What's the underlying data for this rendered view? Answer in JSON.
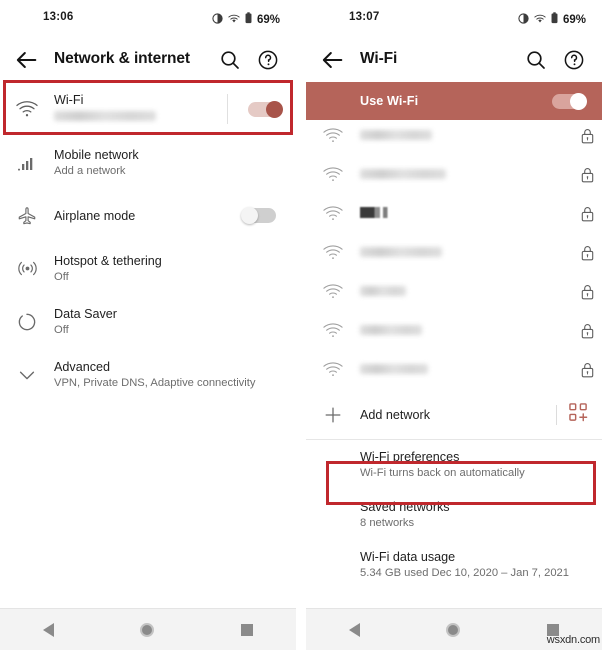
{
  "theme": {
    "accent": "#b5645a",
    "highlight": "#c0282d",
    "banner_bg": "#b5645a",
    "toggle_on_thumb": "#a8544a",
    "toggle_on_track": "#e5cac5",
    "toggle_off_thumb": "#f1f1f1",
    "toggle_off_track": "#cfcfcf",
    "text_primary": "#1f1f1f",
    "text_secondary": "#6d6d6d",
    "nav_bg": "#f3f3f3"
  },
  "watermark": "wsxdn.com",
  "left_panel": {
    "status": {
      "time": "13:06",
      "battery": "69%",
      "icons": [
        "dnd-icon",
        "wifi-icon",
        "battery-icon"
      ]
    },
    "appbar": {
      "back": "back-arrow-icon",
      "title": "Network & internet",
      "search": "search-icon",
      "help": "help-icon"
    },
    "rows": [
      {
        "icon": "wifi-icon",
        "title": "Wi-Fi",
        "subtitle_redacted": true,
        "toggle": "on",
        "highlighted": true
      },
      {
        "icon": "signal-bars-icon",
        "title": "Mobile network",
        "subtitle": "Add a network"
      },
      {
        "icon": "airplane-icon",
        "title": "Airplane mode",
        "toggle": "off"
      },
      {
        "icon": "hotspot-icon",
        "title": "Hotspot & tethering",
        "subtitle": "Off"
      },
      {
        "icon": "data-saver-icon",
        "title": "Data Saver",
        "subtitle": "Off"
      },
      {
        "icon": "chevron-down-icon",
        "title": "Advanced",
        "subtitle": "VPN, Private DNS, Adaptive connectivity"
      }
    ],
    "nav": {
      "back": "nav-back-icon",
      "home": "nav-home-icon",
      "recents": "nav-recents-icon"
    }
  },
  "right_panel": {
    "status": {
      "time": "13:07",
      "battery": "69%",
      "icons": [
        "dnd-icon",
        "wifi-icon",
        "battery-icon"
      ]
    },
    "appbar": {
      "back": "back-arrow-icon",
      "title": "Wi-Fi",
      "search": "search-icon",
      "help": "help-icon"
    },
    "banner": {
      "label": "Use Wi-Fi",
      "toggle": "on"
    },
    "networks": [
      {
        "icon": "wifi-icon",
        "ssid_redacted": true,
        "lock": "lock-icon",
        "clipped": true
      },
      {
        "icon": "wifi-icon",
        "ssid_redacted": true,
        "lock": "lock-icon"
      },
      {
        "icon": "wifi-icon",
        "ssid_redacted": true,
        "lock": "lock-icon"
      },
      {
        "icon": "wifi-icon",
        "ssid_redacted": true,
        "lock": "lock-icon",
        "style": "dark"
      },
      {
        "icon": "wifi-icon",
        "ssid_redacted": true,
        "lock": "lock-icon"
      },
      {
        "icon": "wifi-icon",
        "ssid_redacted": true,
        "lock": "lock-icon"
      },
      {
        "icon": "wifi-icon",
        "ssid_redacted": true,
        "lock": "lock-icon"
      },
      {
        "icon": "wifi-icon",
        "ssid_redacted": true,
        "lock": "lock-icon"
      }
    ],
    "add_network": {
      "icon": "plus-icon",
      "label": "Add network",
      "qr": "qr-scanner-icon"
    },
    "options": [
      {
        "title": "Wi-Fi preferences",
        "subtitle": "Wi-Fi turns back on automatically",
        "highlighted": true
      },
      {
        "title": "Saved networks",
        "subtitle": "8 networks"
      },
      {
        "title": "Wi-Fi data usage",
        "subtitle": "5.34 GB used Dec 10, 2020 – Jan 7, 2021"
      }
    ],
    "nav": {
      "back": "nav-back-icon",
      "home": "nav-home-icon",
      "recents": "nav-recents-icon"
    }
  }
}
